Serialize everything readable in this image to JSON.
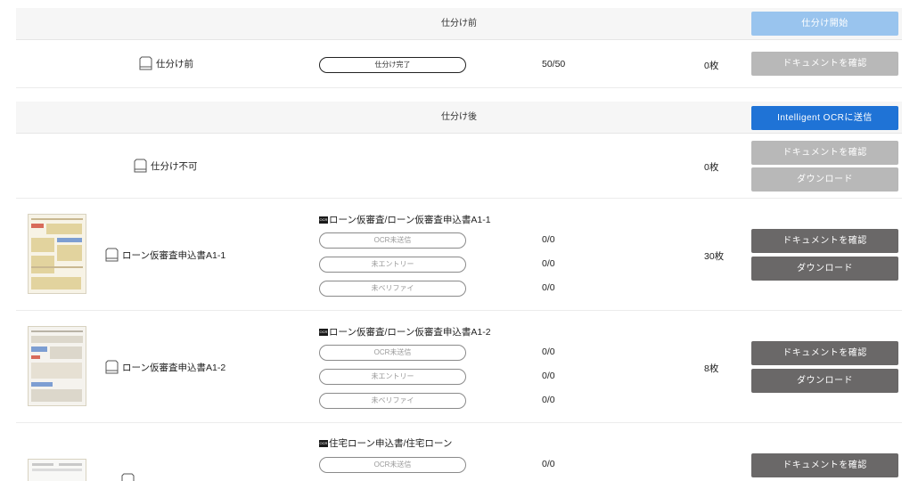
{
  "before": {
    "header": {
      "title": "仕分け前",
      "start_button": "仕分け開始"
    },
    "row": {
      "tray_label": "仕分け前",
      "progress_label": "仕分け完了",
      "progress_fraction": "50/50",
      "progress_value": 1.0,
      "count": "0枚",
      "confirm_button": "ドキュメントを確認"
    }
  },
  "after": {
    "header": {
      "title": "仕分け後",
      "send_button": "Intelligent OCRに送信"
    },
    "unsortable": {
      "tray_label": "仕分け不可",
      "count": "0枚",
      "confirm_button": "ドキュメントを確認",
      "download_button": "ダウンロード"
    },
    "docs": [
      {
        "tray_label": "ローン仮審査申込書A1-1",
        "type_badge": "OCR",
        "type_label": "ローン仮審査/ローン仮審査申込書A1-1",
        "statuses": [
          {
            "label": "OCR未送信",
            "value": "0/0"
          },
          {
            "label": "未エントリー",
            "value": "0/0"
          },
          {
            "label": "未ベリファイ",
            "value": "0/0"
          }
        ],
        "count": "30枚",
        "confirm_button": "ドキュメントを確認",
        "download_button": "ダウンロード"
      },
      {
        "tray_label": "ローン仮審査申込書A1-2",
        "type_badge": "OCR",
        "type_label": "ローン仮審査/ローン仮審査申込書A1-2",
        "statuses": [
          {
            "label": "OCR未送信",
            "value": "0/0"
          },
          {
            "label": "未エントリー",
            "value": "0/0"
          },
          {
            "label": "未ベリファイ",
            "value": "0/0"
          }
        ],
        "count": "8枚",
        "confirm_button": "ドキュメントを確認",
        "download_button": "ダウンロード"
      },
      {
        "type_badge": "OCR",
        "type_label": "住宅ローン申込書/住宅ローン",
        "statuses": [
          {
            "label": "OCR未送信",
            "value": "0/0"
          }
        ],
        "confirm_button": "ドキュメントを確認"
      }
    ]
  },
  "colors": {
    "accent_blue": "#1f73d6",
    "light_blue": "#99c4ee",
    "disabled_gray": "#b8b8b8",
    "dark_gray": "#6a6868"
  }
}
